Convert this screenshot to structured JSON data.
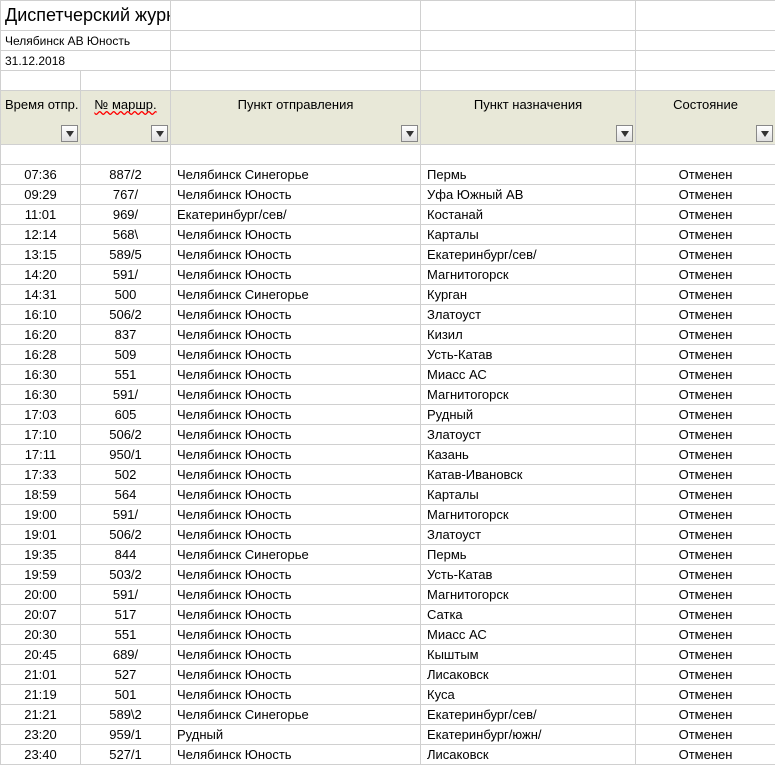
{
  "title": "Диспетчерский журнал",
  "station": "Челябинск АВ Юность",
  "date": "31.12.2018",
  "headers": {
    "time": "Время отпр.",
    "route": "№ маршр.",
    "from": "Пункт отправления",
    "to": "Пункт назначения",
    "status": "Состояние"
  },
  "rows": [
    {
      "time": "07:36",
      "route": "887/2",
      "from": "Челябинск Синегорье",
      "to": "Пермь",
      "status": "Отменен"
    },
    {
      "time": "09:29",
      "route": "767/",
      "from": "Челябинск Юность",
      "to": "Уфа Южный АВ",
      "status": "Отменен"
    },
    {
      "time": "11:01",
      "route": "969/",
      "from": "Екатеринбург/сев/",
      "to": "Костанай",
      "status": "Отменен"
    },
    {
      "time": "12:14",
      "route": "568\\",
      "from": "Челябинск Юность",
      "to": "Карталы",
      "status": "Отменен"
    },
    {
      "time": "13:15",
      "route": "589/5",
      "from": "Челябинск Юность",
      "to": "Екатеринбург/сев/",
      "status": "Отменен"
    },
    {
      "time": "14:20",
      "route": "591/",
      "from": "Челябинск Юность",
      "to": "Магнитогорск",
      "status": "Отменен"
    },
    {
      "time": "14:31",
      "route": "500",
      "from": "Челябинск Синегорье",
      "to": "Курган",
      "status": "Отменен"
    },
    {
      "time": "16:10",
      "route": "506/2",
      "from": "Челябинск Юность",
      "to": "Златоуст",
      "status": "Отменен"
    },
    {
      "time": "16:20",
      "route": "837",
      "from": "Челябинск Юность",
      "to": "Кизил",
      "status": "Отменен"
    },
    {
      "time": "16:28",
      "route": "509",
      "from": "Челябинск Юность",
      "to": "Усть-Катав",
      "status": "Отменен"
    },
    {
      "time": "16:30",
      "route": "551",
      "from": "Челябинск Юность",
      "to": "Миасс АС",
      "status": "Отменен"
    },
    {
      "time": "16:30",
      "route": "591/",
      "from": "Челябинск Юность",
      "to": "Магнитогорск",
      "status": "Отменен"
    },
    {
      "time": "17:03",
      "route": "605",
      "from": "Челябинск Юность",
      "to": "Рудный",
      "status": "Отменен"
    },
    {
      "time": "17:10",
      "route": "506/2",
      "from": "Челябинск Юность",
      "to": "Златоуст",
      "status": "Отменен"
    },
    {
      "time": "17:11",
      "route": "950/1",
      "from": "Челябинск Юность",
      "to": "Казань",
      "status": "Отменен"
    },
    {
      "time": "17:33",
      "route": "502",
      "from": "Челябинск Юность",
      "to": "Катав-Ивановск",
      "status": "Отменен"
    },
    {
      "time": "18:59",
      "route": "564",
      "from": "Челябинск Юность",
      "to": "Карталы",
      "status": "Отменен"
    },
    {
      "time": "19:00",
      "route": "591/",
      "from": "Челябинск Юность",
      "to": "Магнитогорск",
      "status": "Отменен"
    },
    {
      "time": "19:01",
      "route": "506/2",
      "from": "Челябинск Юность",
      "to": "Златоуст",
      "status": "Отменен"
    },
    {
      "time": "19:35",
      "route": "844",
      "from": "Челябинск Синегорье",
      "to": "Пермь",
      "status": "Отменен"
    },
    {
      "time": "19:59",
      "route": "503/2",
      "from": "Челябинск Юность",
      "to": "Усть-Катав",
      "status": "Отменен"
    },
    {
      "time": "20:00",
      "route": "591/",
      "from": "Челябинск Юность",
      "to": "Магнитогорск",
      "status": "Отменен"
    },
    {
      "time": "20:07",
      "route": "517",
      "from": "Челябинск Юность",
      "to": "Сатка",
      "status": "Отменен"
    },
    {
      "time": "20:30",
      "route": "551",
      "from": "Челябинск Юность",
      "to": "Миасс АС",
      "status": "Отменен"
    },
    {
      "time": "20:45",
      "route": "689/",
      "from": "Челябинск Юность",
      "to": "Кыштым",
      "status": "Отменен"
    },
    {
      "time": "21:01",
      "route": "527",
      "from": "Челябинск Юность",
      "to": "Лисаковск",
      "status": "Отменен"
    },
    {
      "time": "21:19",
      "route": "501",
      "from": "Челябинск Юность",
      "to": "Куса",
      "status": "Отменен"
    },
    {
      "time": "21:21",
      "route": "589\\2",
      "from": "Челябинск Синегорье",
      "to": "Екатеринбург/сев/",
      "status": "Отменен"
    },
    {
      "time": "23:20",
      "route": "959/1",
      "from": "Рудный",
      "to": "Екатеринбург/южн/",
      "status": "Отменен"
    },
    {
      "time": "23:40",
      "route": "527/1",
      "from": "Челябинск Юность",
      "to": "Лисаковск",
      "status": "Отменен"
    }
  ]
}
